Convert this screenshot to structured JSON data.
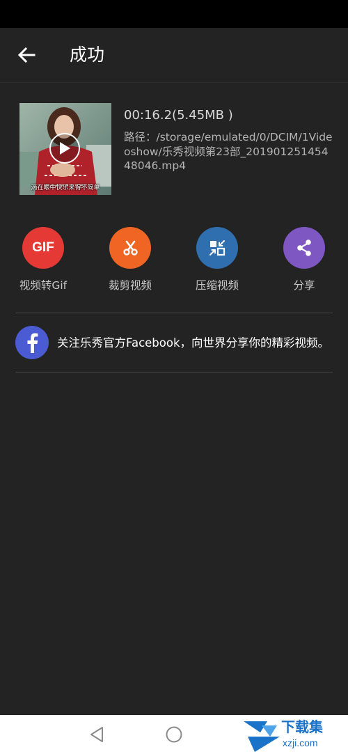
{
  "colors": {
    "background": "#232323",
    "gif_button": "#e53935",
    "trim_button": "#f06524",
    "compress_button": "#2f6fb0",
    "share_button": "#7e57c2",
    "facebook": "#4a5bd4",
    "watermark": "#1a72c9"
  },
  "header": {
    "back_icon": "arrow-left-icon",
    "title": "成功"
  },
  "video": {
    "duration_size": "00:16.2(5.45MB )",
    "path": "路径：/storage/emulated/0/DCIM/1Videoshow/乐秀视频第23部_20190125145448046.mp4",
    "thumbnail_caption": "滴在眼中快乐来得不简单",
    "play_icon": "play-icon"
  },
  "actions": [
    {
      "label": "视频转Gif",
      "icon": "gif-icon",
      "icon_text": "GIF"
    },
    {
      "label": "裁剪视频",
      "icon": "scissors-icon"
    },
    {
      "label": "压缩视频",
      "icon": "compress-icon"
    },
    {
      "label": "分享",
      "icon": "share-icon"
    }
  ],
  "facebook": {
    "icon": "facebook-icon",
    "text": "关注乐秀官方Facebook，向世界分享你的精彩视频。"
  },
  "nav": {
    "back": "triangle-back-icon",
    "home": "circle-home-icon",
    "recents": "square-recents-icon"
  },
  "watermark": {
    "line1": "下载集",
    "line2": "xzji.com"
  }
}
